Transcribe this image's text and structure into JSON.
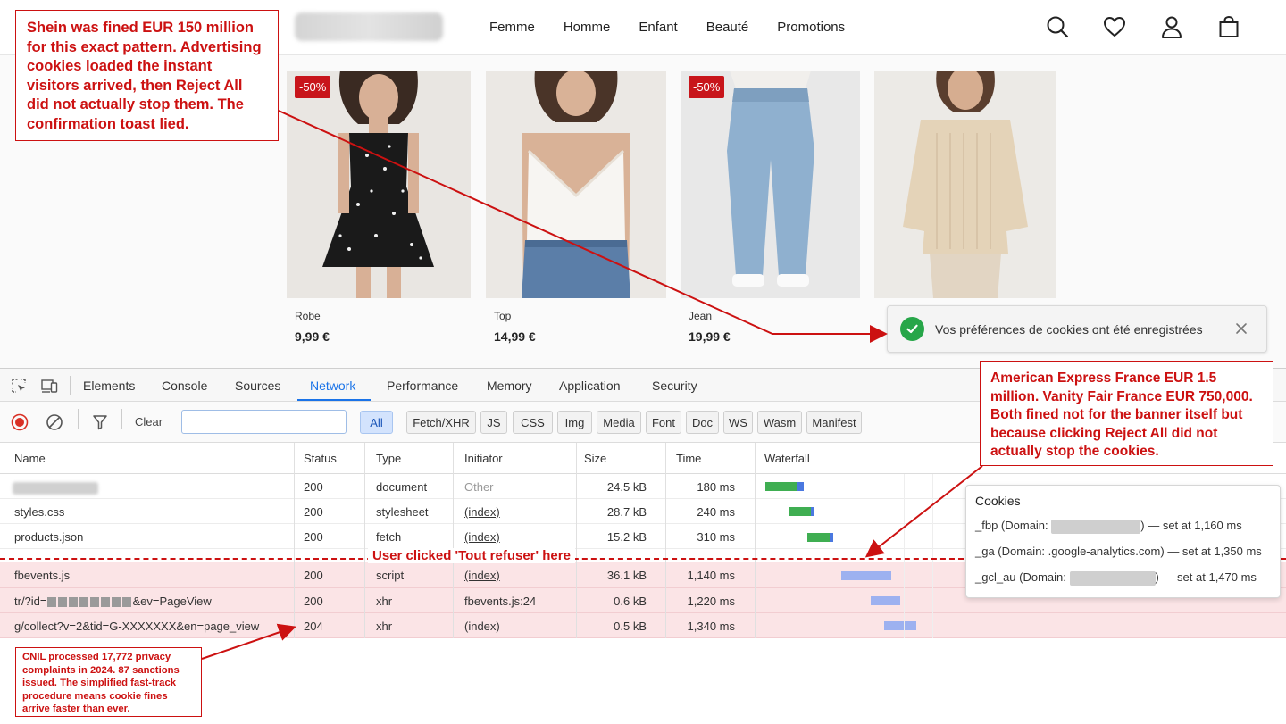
{
  "header": {
    "nav": [
      "Femme",
      "Homme",
      "Enfant",
      "Beauté",
      "Promotions"
    ]
  },
  "products": [
    {
      "name": "Robe",
      "price": "9,99 €",
      "badge": "-50%"
    },
    {
      "name": "Top",
      "price": "14,99 €",
      "badge": ""
    },
    {
      "name": "Jean",
      "price": "19,99 €",
      "badge": "-50%"
    },
    {
      "name": "",
      "price": "",
      "badge": ""
    }
  ],
  "toast": {
    "text": "Vos préférences de cookies ont été enregistrées",
    "success_color": "#27a649"
  },
  "devtools": {
    "tabs": [
      "Elements",
      "Console",
      "Sources",
      "Network",
      "Performance",
      "Memory",
      "Application",
      "Security"
    ],
    "active_tab": "Network",
    "toolbar": {
      "clear_label": "Clear",
      "filter_value": "",
      "chips": [
        "All",
        "Fetch/XHR",
        "JS",
        "CSS",
        "Img",
        "Media",
        "Font",
        "Doc",
        "WS",
        "Wasm",
        "Manifest"
      ],
      "active_chip": "All"
    },
    "columns": [
      "Name",
      "Status",
      "Type",
      "Initiator",
      "Size",
      "Time",
      "Waterfall"
    ],
    "rows": [
      {
        "name": "",
        "status": "200",
        "type": "document",
        "initiator": "Other",
        "size": "24.5 kB",
        "time": "180 ms"
      },
      {
        "name": "styles.css",
        "status": "200",
        "type": "stylesheet",
        "initiator": "(index)",
        "size": "28.7 kB",
        "time": "240 ms"
      },
      {
        "name": "products.json",
        "status": "200",
        "type": "fetch",
        "initiator": "(index)",
        "size": "15.2 kB",
        "time": "310 ms"
      },
      {
        "name": "fbevents.js",
        "status": "200",
        "type": "script",
        "initiator": "(index)",
        "size": "36.1 kB",
        "time": "1,140 ms"
      },
      {
        "name_prefix": "tr/?id=",
        "name_suffix": "&ev=PageView",
        "status": "200",
        "type": "xhr",
        "initiator": "fbevents.js:24",
        "size": "0.6 kB",
        "time": "1,220 ms"
      },
      {
        "name": "g/collect?v=2&tid=G-XXXXXXX&en=page_view",
        "status": "204",
        "type": "xhr",
        "initiator": "(index)",
        "size": "0.5 kB",
        "time": "1,340 ms"
      }
    ],
    "divider_label": "User clicked 'Tout refuser' here"
  },
  "cookies_popover": {
    "title": "Cookies",
    "items": [
      {
        "prefix": "_fbp (Domain: ",
        "suffix": ") — set at 1,160 ms"
      },
      {
        "text": "_ga (Domain: .google-analytics.com) — set at 1,350 ms"
      },
      {
        "prefix": "_gcl_au (Domain: ",
        "suffix": ") — set at 1,470 ms"
      }
    ]
  },
  "annotations": {
    "shein": "Shein was fined EUR 150 million for this exact pattern. Advertising cookies loaded the instant visitors arrived, then Reject All did not actually stop them. The confirmation toast lied.",
    "amex": "American Express France EUR 1.5 million. Vanity Fair France EUR 750,000. Both fined not for the banner itself but because clicking Reject All did not actually stop the cookies.",
    "cnil": "CNIL processed 17,772 privacy complaints in 2024. 87 sanctions issued. The simplified fast-track procedure means cookie fines arrive faster than ever.",
    "color": "#cc1111"
  }
}
